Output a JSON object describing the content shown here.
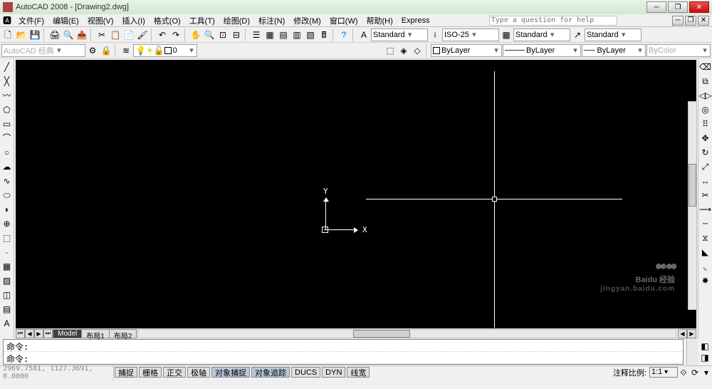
{
  "title": "AutoCAD 2008 - [Drawing2.dwg]",
  "help_placeholder": "Type a question for help",
  "menu": [
    "文件(F)",
    "编辑(E)",
    "视图(V)",
    "插入(I)",
    "格式(O)",
    "工具(T)",
    "绘图(D)",
    "标注(N)",
    "修改(M)",
    "窗口(W)",
    "帮助(H)",
    "Express"
  ],
  "workspace_combo": "AutoCAD 经典",
  "layer_combo": "0",
  "style_combos": {
    "text_style": "Standard",
    "dim_style": "ISO-25",
    "table_style": "Standard",
    "mleader_style": "Standard"
  },
  "props": {
    "color": "ByLayer",
    "linetype": "ByLayer",
    "lineweight": "ByLayer",
    "plotstyle": "ByColor"
  },
  "ucs": {
    "x": "X",
    "y": "Y"
  },
  "tabs": {
    "model": "Model",
    "layout1": "布局1",
    "layout2": "布局2"
  },
  "cmd": {
    "line1": "命令:",
    "line2": "命令:"
  },
  "status": {
    "coords": "2969.7581, 1127.3691, 0.0000",
    "buttons": [
      "捕捉",
      "栅格",
      "正交",
      "极轴",
      "对象捕捉",
      "对象追踪",
      "DUCS",
      "DYN",
      "线宽"
    ],
    "anno_label": "注释比例:",
    "scale": "1:1"
  },
  "watermark": {
    "brand": "Baidu 经验",
    "sub": "jingyan.baidu.com"
  }
}
